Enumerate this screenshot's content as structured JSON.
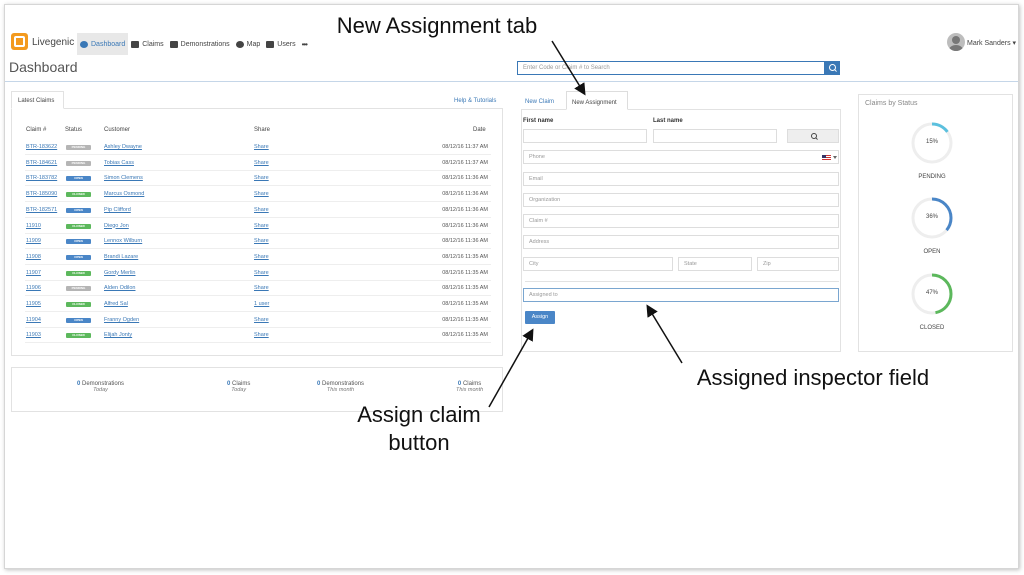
{
  "navbar": {
    "brand": "Livegenic",
    "items": [
      {
        "label": "Dashboard",
        "icon": "dashboard-icon"
      },
      {
        "label": "Claims",
        "icon": "list-icon"
      },
      {
        "label": "Demonstrations",
        "icon": "film-icon"
      },
      {
        "label": "Map",
        "icon": "globe-icon"
      },
      {
        "label": "Users",
        "icon": "users-icon"
      }
    ],
    "more": "•••",
    "user_name": "Mark Sanders ▾"
  },
  "header": {
    "title": "Dashboard",
    "search_placeholder": "Enter Code or Claim # to Search"
  },
  "latest_claims": {
    "tab_label": "Latest Claims",
    "help_link": "Help & Tutorials",
    "columns": [
      "Claim #",
      "Status",
      "Customer",
      "Share",
      "Date"
    ],
    "rows": [
      {
        "claim": "BTR-183622",
        "status": "PENDING",
        "customer": "Ashley Dwayne",
        "share": "Share",
        "date": "08/12/16 11:37 AM"
      },
      {
        "claim": "BTR-184621",
        "status": "PENDING",
        "customer": "Tobias Cass",
        "share": "Share",
        "date": "08/12/16 11:37 AM"
      },
      {
        "claim": "BTR-183782",
        "status": "OPEN",
        "customer": "Simon Clemens",
        "share": "Share",
        "date": "08/12/16 11:36 AM"
      },
      {
        "claim": "BTR-185090",
        "status": "CLOSED",
        "customer": "Marcus Osmond",
        "share": "Share",
        "date": "08/12/16 11:36 AM"
      },
      {
        "claim": "BTR-182571",
        "status": "OPEN",
        "customer": "Pip Clifford",
        "share": "Share",
        "date": "08/12/16 11:36 AM"
      },
      {
        "claim": "11910",
        "status": "CLOSED",
        "customer": "Diego Jon",
        "share": "Share",
        "date": "08/12/16 11:36 AM"
      },
      {
        "claim": "11909",
        "status": "OPEN",
        "customer": "Lennox Wilburn",
        "share": "Share",
        "date": "08/12/16 11:36 AM"
      },
      {
        "claim": "11908",
        "status": "OPEN",
        "customer": "Brandi Lazare",
        "share": "Share",
        "date": "08/12/16 11:35 AM"
      },
      {
        "claim": "11907",
        "status": "CLOSED",
        "customer": "Gordy Merlin",
        "share": "Share",
        "date": "08/12/16 11:35 AM"
      },
      {
        "claim": "11906",
        "status": "PENDING",
        "customer": "Alden Odilon",
        "share": "Share",
        "date": "08/12/16 11:35 AM"
      },
      {
        "claim": "11905",
        "status": "CLOSED",
        "customer": "Alfred Sal",
        "share": "1 user",
        "date": "08/12/16 11:35 AM"
      },
      {
        "claim": "11904",
        "status": "OPEN",
        "customer": "Franny Ogden",
        "share": "Share",
        "date": "08/12/16 11:35 AM"
      },
      {
        "claim": "11903",
        "status": "CLOSED",
        "customer": "Elijah Jonty",
        "share": "Share",
        "date": "08/12/16 11:35 AM"
      }
    ]
  },
  "stats": [
    {
      "value": "0",
      "label": "Demonstrations",
      "period": "Today"
    },
    {
      "value": "0",
      "label": "Claims",
      "period": "Today"
    },
    {
      "value": "0",
      "label": "Demonstrations",
      "period": "This month"
    },
    {
      "value": "0",
      "label": "Claims",
      "period": "This month"
    }
  ],
  "form": {
    "tabs": [
      "New Claim",
      "New Assignment"
    ],
    "first_name_label": "First name",
    "last_name_label": "Last name",
    "phone_placeholder": "Phone",
    "email_placeholder": "Email",
    "organization_placeholder": "Organization",
    "claim_placeholder": "Claim #",
    "address_placeholder": "Address",
    "city_placeholder": "City",
    "state_placeholder": "State",
    "zip_placeholder": "Zip",
    "assigned_placeholder": "Assigned to",
    "assign_button": "Assign"
  },
  "claims_by_status": {
    "title": "Claims by Status",
    "items": [
      {
        "percent": "15%",
        "value": 15,
        "label": "PENDING",
        "color": "#5bc0de"
      },
      {
        "percent": "36%",
        "value": 36,
        "label": "OPEN",
        "color": "#4a86c7"
      },
      {
        "percent": "47%",
        "value": 47,
        "label": "CLOSED",
        "color": "#5cb85c"
      }
    ]
  },
  "status_colors": {
    "PENDING": "#b5b5b5",
    "OPEN": "#4a86c7",
    "CLOSED": "#5cb85c"
  },
  "annotations": {
    "new_assignment_tab": "New Assignment tab",
    "assigned_inspector_field": "Assigned inspector field",
    "assign_claim_button": "Assign claim button"
  }
}
